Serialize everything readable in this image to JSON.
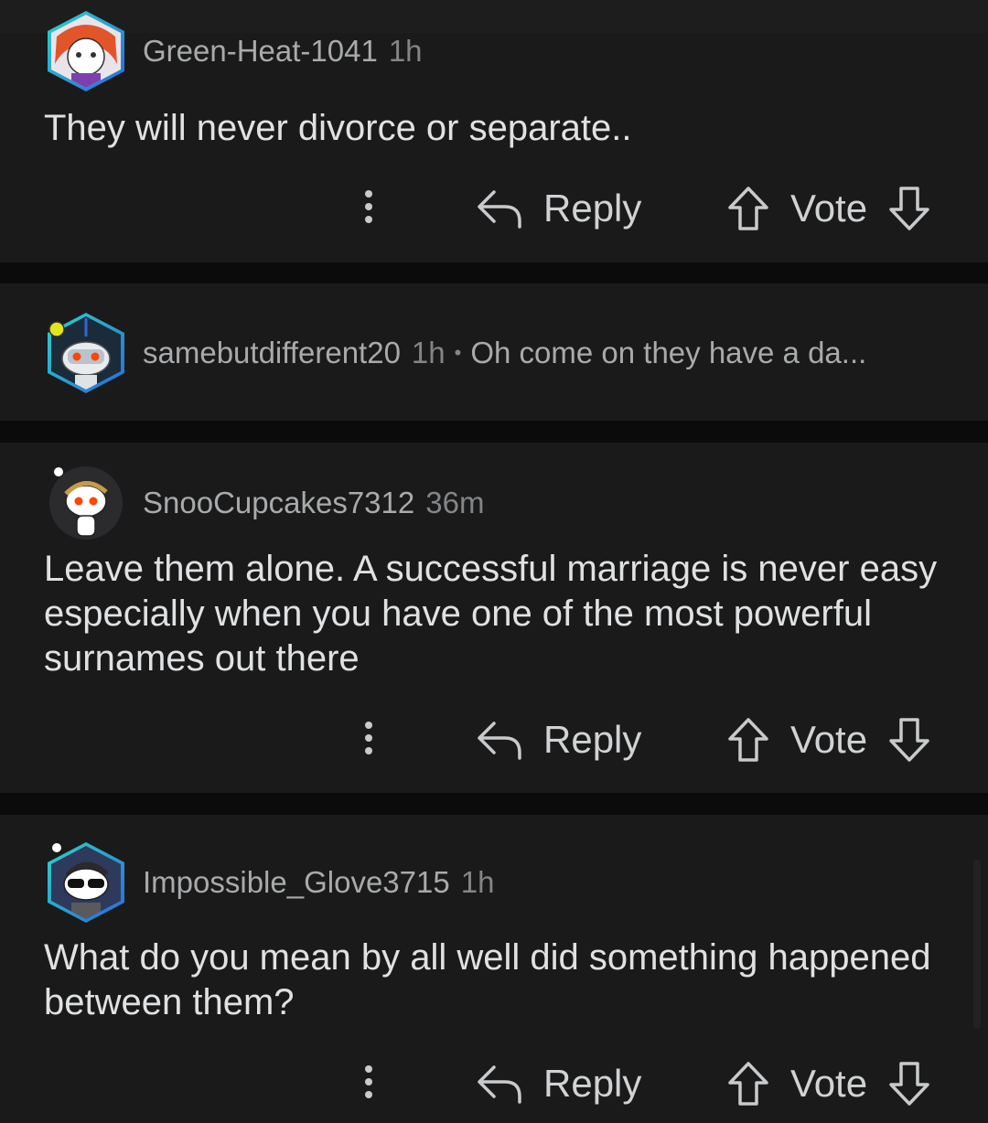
{
  "comments": [
    {
      "username": "Green-Heat-1041",
      "time": "1h",
      "text": "They will never divorce or separate..",
      "avatar_icon": "anime-girl-avatar-icon",
      "reply_label": "Reply",
      "vote_label": "Vote"
    },
    {
      "username": "samebutdifferent20",
      "time": "1h",
      "separator": "•",
      "preview": "Oh come on they have a da...",
      "avatar_icon": "robot-snoo-avatar-icon",
      "collapsed": true
    },
    {
      "username": "SnooCupcakes7312",
      "time": "36m",
      "text": "Leave them alone. A successful marriage is never easy especially when you have one of the most powerful surnames out there",
      "avatar_icon": "snoo-avatar-icon",
      "reply_label": "Reply",
      "vote_label": "Vote"
    },
    {
      "username": "Impossible_Glove3715",
      "time": "1h",
      "text": "What do you mean by all well did something happened between them?",
      "avatar_icon": "sunglasses-snoo-avatar-icon",
      "reply_label": "Reply",
      "vote_label": "Vote"
    }
  ],
  "colors": {
    "background": "#0b0b0b",
    "card": "#1a1a1b",
    "text": "#e0e1e2",
    "muted": "#838587",
    "nft_border_gradient": [
      "#2bd4c8",
      "#2a6ad8"
    ]
  }
}
